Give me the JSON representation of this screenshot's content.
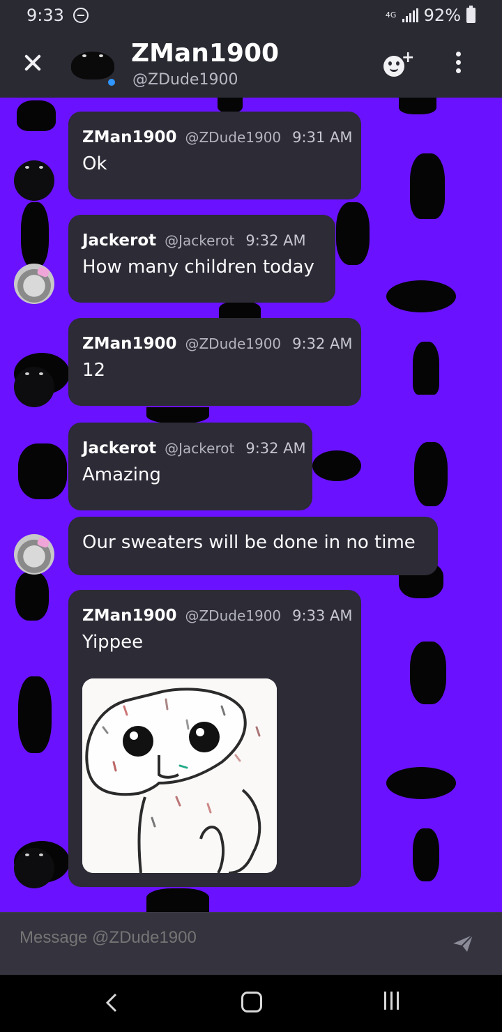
{
  "status_bar": {
    "time": "9:33",
    "network": "4G",
    "battery": "92%"
  },
  "header": {
    "title": "ZMan1900",
    "subtitle": "@ZDude1900"
  },
  "messages": [
    {
      "author": "ZMan1900",
      "handle": "@ZDude1900",
      "time": "9:31 AM",
      "text": "Ok"
    },
    {
      "author": "Jackerot",
      "handle": "@Jackerot",
      "time": "9:32 AM",
      "text": "How many children today"
    },
    {
      "author": "ZMan1900",
      "handle": "@ZDude1900",
      "time": "9:32 AM",
      "text": "12"
    },
    {
      "author": "Jackerot",
      "handle": "@Jackerot",
      "time": "9:32 AM",
      "text": "Amazing"
    },
    {
      "author": "Jackerot",
      "text": "Our sweaters will be done in no time"
    },
    {
      "author": "ZMan1900",
      "handle": "@ZDude1900",
      "time": "9:33 AM",
      "text": "Yippee",
      "attachment": "gif"
    }
  ],
  "composer": {
    "placeholder": "Message @ZDude1900"
  },
  "colors": {
    "chat_background": "#6a12ff",
    "bubble": "#2c2b36",
    "online": "#2f96ff"
  }
}
